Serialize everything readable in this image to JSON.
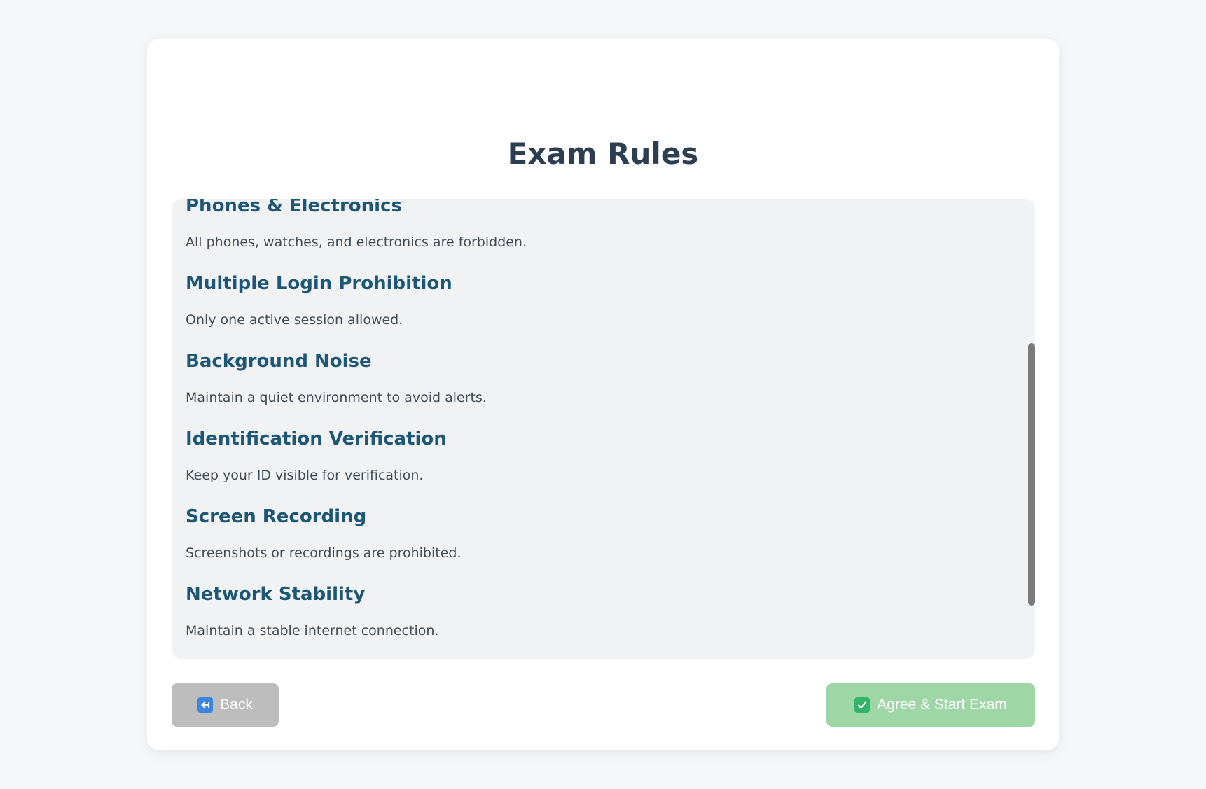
{
  "page": {
    "title": "Exam Rules"
  },
  "rules": [
    {
      "title": "Phones & Electronics",
      "description": "All phones, watches, and electronics are forbidden."
    },
    {
      "title": "Multiple Login Prohibition",
      "description": "Only one active session allowed."
    },
    {
      "title": "Background Noise",
      "description": "Maintain a quiet environment to avoid alerts."
    },
    {
      "title": "Identification Verification",
      "description": "Keep your ID visible for verification."
    },
    {
      "title": "Screen Recording",
      "description": "Screenshots or recordings are prohibited."
    },
    {
      "title": "Network Stability",
      "description": "Maintain a stable internet connection."
    }
  ],
  "buttons": {
    "back_label": "Back",
    "back_icon": "back-arrow-icon",
    "start_label": "Agree & Start Exam",
    "start_icon": "checkmark-icon"
  },
  "colors": {
    "title": "#2c3e50",
    "rule_title": "#1e5676",
    "back_button": "#bdbdbd",
    "start_button": "#9ed7a5"
  }
}
